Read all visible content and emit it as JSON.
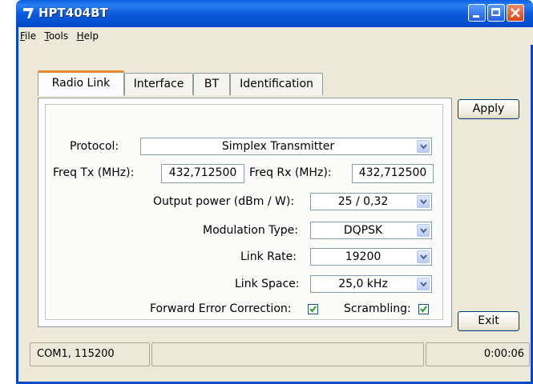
{
  "window": {
    "title": "HPT404BT"
  },
  "menu": [
    "File",
    "Tools",
    "Help"
  ],
  "tabs": [
    "Radio Link",
    "Interface",
    "BT",
    "Identification"
  ],
  "form": {
    "protocol_label": "Protocol:",
    "protocol_value": "Simplex Transmitter",
    "freq_tx_label": "Freq Tx (MHz):",
    "freq_tx_value": "432,712500",
    "freq_rx_label": "Freq Rx (MHz):",
    "freq_rx_value": "432,712500",
    "output_power_label": "Output power (dBm / W):",
    "output_power_value": "25 / 0,32",
    "modulation_label": "Modulation Type:",
    "modulation_value": "DQPSK",
    "link_rate_label": "Link Rate:",
    "link_rate_value": "19200",
    "link_space_label": "Link Space:",
    "link_space_value": "25,0 kHz",
    "fec_label": "Forward Error Correction:",
    "fec_checked": true,
    "scrambling_label": "Scrambling:",
    "scrambling_checked": true
  },
  "buttons": {
    "apply": "Apply",
    "exit": "Exit"
  },
  "statusbar": {
    "port": "COM1, 115200",
    "middle": "",
    "time": "0:00:06"
  },
  "colors": {
    "titlebar": "#0a59d8",
    "active_tab_accent": "#e68b2c",
    "check": "#21a121"
  }
}
